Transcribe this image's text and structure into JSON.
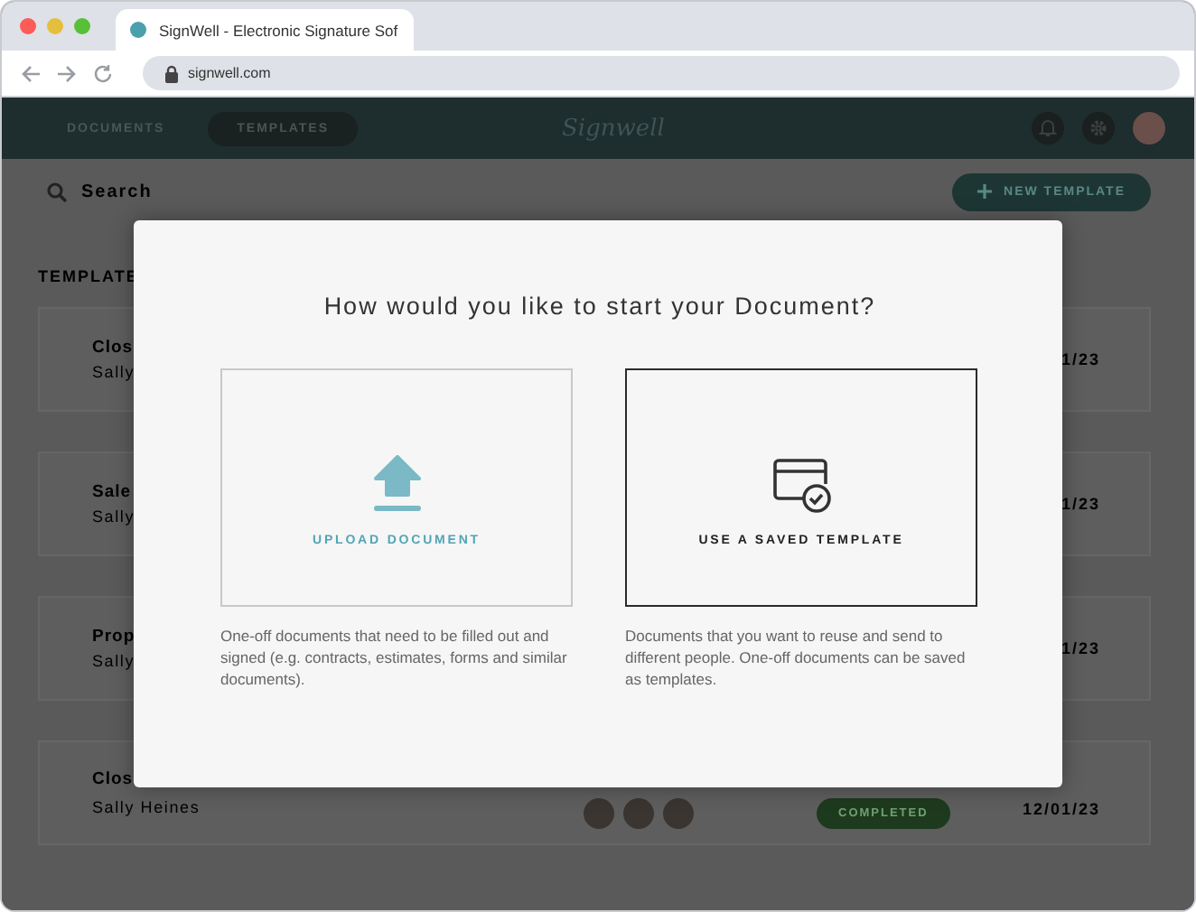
{
  "browser": {
    "tab_title": "SignWell - Electronic Signature Sof",
    "url": "signwell.com"
  },
  "app_header": {
    "tabs": [
      {
        "label": "DOCUMENTS",
        "selected": false
      },
      {
        "label": "TEMPLATES",
        "selected": true
      }
    ],
    "logo": "Signwell"
  },
  "toolbar": {
    "search_placeholder": "Search",
    "new_button": "NEW TEMPLATE"
  },
  "section_title": "TEMPLATE",
  "rows": [
    {
      "title": "Clos",
      "owner": "Sally",
      "date": "1/23"
    },
    {
      "title": "Sale",
      "owner": "Sally",
      "date": "1/23"
    },
    {
      "title": "Prop",
      "owner": "Sally",
      "date": "1/23"
    },
    {
      "title": "Clos",
      "owner": "Sally Heines",
      "date": "12/01/23",
      "status": "COMPLETED"
    }
  ],
  "modal": {
    "title": "How would you like to start your Document?",
    "options": [
      {
        "kind": "upload",
        "label": "UPLOAD DOCUMENT",
        "description": "One-off documents that need to be filled out and signed (e.g. contracts, estimates, forms and similar documents).",
        "selected": false
      },
      {
        "kind": "template",
        "label": "USE A SAVED TEMPLATE",
        "description": "Documents that you want to reuse and send to different people. One-off documents can be saved as templates.",
        "selected": true
      }
    ]
  }
}
